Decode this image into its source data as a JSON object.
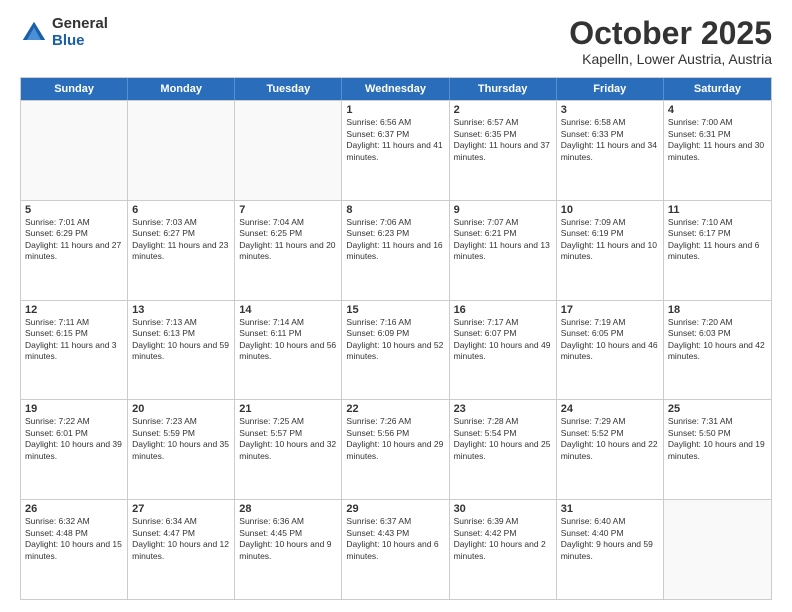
{
  "header": {
    "logo_general": "General",
    "logo_blue": "Blue",
    "month_title": "October 2025",
    "subtitle": "Kapelln, Lower Austria, Austria"
  },
  "days_of_week": [
    "Sunday",
    "Monday",
    "Tuesday",
    "Wednesday",
    "Thursday",
    "Friday",
    "Saturday"
  ],
  "rows": [
    [
      {
        "day": "",
        "empty": true
      },
      {
        "day": "",
        "empty": true
      },
      {
        "day": "",
        "empty": true
      },
      {
        "day": "1",
        "sunrise": "Sunrise: 6:56 AM",
        "sunset": "Sunset: 6:37 PM",
        "daylight": "Daylight: 11 hours and 41 minutes."
      },
      {
        "day": "2",
        "sunrise": "Sunrise: 6:57 AM",
        "sunset": "Sunset: 6:35 PM",
        "daylight": "Daylight: 11 hours and 37 minutes."
      },
      {
        "day": "3",
        "sunrise": "Sunrise: 6:58 AM",
        "sunset": "Sunset: 6:33 PM",
        "daylight": "Daylight: 11 hours and 34 minutes."
      },
      {
        "day": "4",
        "sunrise": "Sunrise: 7:00 AM",
        "sunset": "Sunset: 6:31 PM",
        "daylight": "Daylight: 11 hours and 30 minutes."
      }
    ],
    [
      {
        "day": "5",
        "sunrise": "Sunrise: 7:01 AM",
        "sunset": "Sunset: 6:29 PM",
        "daylight": "Daylight: 11 hours and 27 minutes."
      },
      {
        "day": "6",
        "sunrise": "Sunrise: 7:03 AM",
        "sunset": "Sunset: 6:27 PM",
        "daylight": "Daylight: 11 hours and 23 minutes."
      },
      {
        "day": "7",
        "sunrise": "Sunrise: 7:04 AM",
        "sunset": "Sunset: 6:25 PM",
        "daylight": "Daylight: 11 hours and 20 minutes."
      },
      {
        "day": "8",
        "sunrise": "Sunrise: 7:06 AM",
        "sunset": "Sunset: 6:23 PM",
        "daylight": "Daylight: 11 hours and 16 minutes."
      },
      {
        "day": "9",
        "sunrise": "Sunrise: 7:07 AM",
        "sunset": "Sunset: 6:21 PM",
        "daylight": "Daylight: 11 hours and 13 minutes."
      },
      {
        "day": "10",
        "sunrise": "Sunrise: 7:09 AM",
        "sunset": "Sunset: 6:19 PM",
        "daylight": "Daylight: 11 hours and 10 minutes."
      },
      {
        "day": "11",
        "sunrise": "Sunrise: 7:10 AM",
        "sunset": "Sunset: 6:17 PM",
        "daylight": "Daylight: 11 hours and 6 minutes."
      }
    ],
    [
      {
        "day": "12",
        "sunrise": "Sunrise: 7:11 AM",
        "sunset": "Sunset: 6:15 PM",
        "daylight": "Daylight: 11 hours and 3 minutes."
      },
      {
        "day": "13",
        "sunrise": "Sunrise: 7:13 AM",
        "sunset": "Sunset: 6:13 PM",
        "daylight": "Daylight: 10 hours and 59 minutes."
      },
      {
        "day": "14",
        "sunrise": "Sunrise: 7:14 AM",
        "sunset": "Sunset: 6:11 PM",
        "daylight": "Daylight: 10 hours and 56 minutes."
      },
      {
        "day": "15",
        "sunrise": "Sunrise: 7:16 AM",
        "sunset": "Sunset: 6:09 PM",
        "daylight": "Daylight: 10 hours and 52 minutes."
      },
      {
        "day": "16",
        "sunrise": "Sunrise: 7:17 AM",
        "sunset": "Sunset: 6:07 PM",
        "daylight": "Daylight: 10 hours and 49 minutes."
      },
      {
        "day": "17",
        "sunrise": "Sunrise: 7:19 AM",
        "sunset": "Sunset: 6:05 PM",
        "daylight": "Daylight: 10 hours and 46 minutes."
      },
      {
        "day": "18",
        "sunrise": "Sunrise: 7:20 AM",
        "sunset": "Sunset: 6:03 PM",
        "daylight": "Daylight: 10 hours and 42 minutes."
      }
    ],
    [
      {
        "day": "19",
        "sunrise": "Sunrise: 7:22 AM",
        "sunset": "Sunset: 6:01 PM",
        "daylight": "Daylight: 10 hours and 39 minutes."
      },
      {
        "day": "20",
        "sunrise": "Sunrise: 7:23 AM",
        "sunset": "Sunset: 5:59 PM",
        "daylight": "Daylight: 10 hours and 35 minutes."
      },
      {
        "day": "21",
        "sunrise": "Sunrise: 7:25 AM",
        "sunset": "Sunset: 5:57 PM",
        "daylight": "Daylight: 10 hours and 32 minutes."
      },
      {
        "day": "22",
        "sunrise": "Sunrise: 7:26 AM",
        "sunset": "Sunset: 5:56 PM",
        "daylight": "Daylight: 10 hours and 29 minutes."
      },
      {
        "day": "23",
        "sunrise": "Sunrise: 7:28 AM",
        "sunset": "Sunset: 5:54 PM",
        "daylight": "Daylight: 10 hours and 25 minutes."
      },
      {
        "day": "24",
        "sunrise": "Sunrise: 7:29 AM",
        "sunset": "Sunset: 5:52 PM",
        "daylight": "Daylight: 10 hours and 22 minutes."
      },
      {
        "day": "25",
        "sunrise": "Sunrise: 7:31 AM",
        "sunset": "Sunset: 5:50 PM",
        "daylight": "Daylight: 10 hours and 19 minutes."
      }
    ],
    [
      {
        "day": "26",
        "sunrise": "Sunrise: 6:32 AM",
        "sunset": "Sunset: 4:48 PM",
        "daylight": "Daylight: 10 hours and 15 minutes."
      },
      {
        "day": "27",
        "sunrise": "Sunrise: 6:34 AM",
        "sunset": "Sunset: 4:47 PM",
        "daylight": "Daylight: 10 hours and 12 minutes."
      },
      {
        "day": "28",
        "sunrise": "Sunrise: 6:36 AM",
        "sunset": "Sunset: 4:45 PM",
        "daylight": "Daylight: 10 hours and 9 minutes."
      },
      {
        "day": "29",
        "sunrise": "Sunrise: 6:37 AM",
        "sunset": "Sunset: 4:43 PM",
        "daylight": "Daylight: 10 hours and 6 minutes."
      },
      {
        "day": "30",
        "sunrise": "Sunrise: 6:39 AM",
        "sunset": "Sunset: 4:42 PM",
        "daylight": "Daylight: 10 hours and 2 minutes."
      },
      {
        "day": "31",
        "sunrise": "Sunrise: 6:40 AM",
        "sunset": "Sunset: 4:40 PM",
        "daylight": "Daylight: 9 hours and 59 minutes."
      },
      {
        "day": "",
        "empty": true
      }
    ]
  ]
}
